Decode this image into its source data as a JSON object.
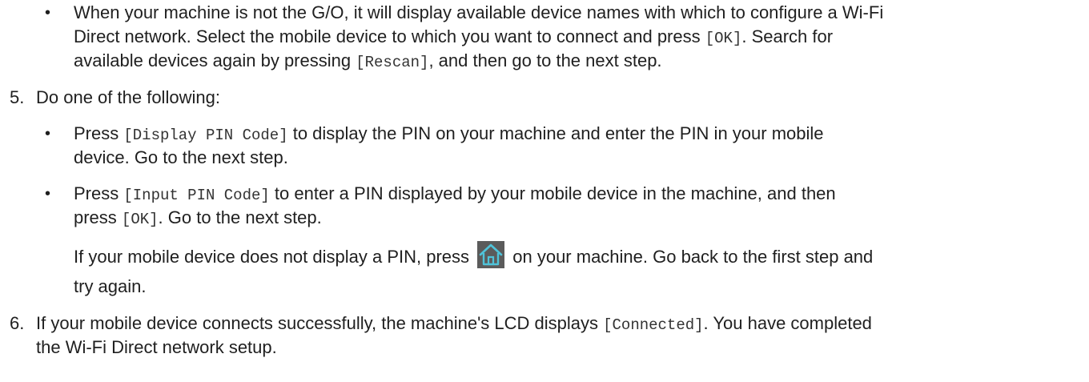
{
  "bullets": {
    "b0": {
      "l1": "When your machine is not the G/O, it will display available device names with which to configure a Wi-Fi",
      "l2a": "Direct network. Select the mobile device to which you want to connect and press ",
      "l2b": "[OK]",
      "l2c": ". Search for",
      "l3a": "available devices again by pressing ",
      "l3b": "[Rescan]",
      "l3c": ", and then go to the next step."
    },
    "b1": {
      "l1a": "Press ",
      "l1b": "[Display PIN Code]",
      "l1c": " to display the PIN on your machine and enter the PIN in your mobile",
      "l2": "device. Go to the next step."
    },
    "b2": {
      "l1a": "Press ",
      "l1b": "[Input PIN Code]",
      "l1c": " to enter a PIN displayed by your mobile device in the machine, and then",
      "l2a": "press ",
      "l2b": "[OK]",
      "l2c": ". Go to the next step."
    }
  },
  "steps": {
    "s5": {
      "number": "5.",
      "text": "Do one of the following:"
    },
    "s6": {
      "number": "6.",
      "l1a": "If your mobile device connects successfully, the machine's LCD displays ",
      "l1b": "[Connected]",
      "l1c": ". You have completed",
      "l2": "the Wi-Fi Direct network setup."
    }
  },
  "note": {
    "l1a": "If your mobile device does not display a PIN, press ",
    "l1b": " on your machine. Go back to the first step and",
    "l2": "try again.",
    "icon": "home-icon",
    "icon_color": "#5b5b5b"
  },
  "bullet_glyph": "•"
}
